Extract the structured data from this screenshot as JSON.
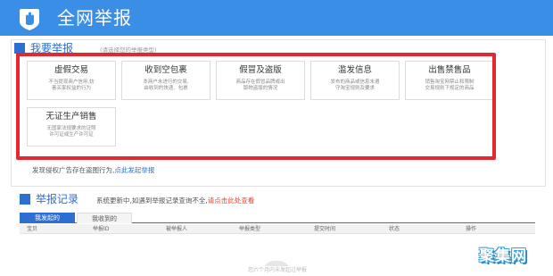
{
  "header": {
    "title": "全网举报"
  },
  "report_section": {
    "title": "我要举报",
    "hint": "(请选择您的举报类型)",
    "categories": [
      {
        "title": "虚假交易",
        "desc": "不当提现商户信用,妨\n害买家权益的行为"
      },
      {
        "title": "收到空包裹",
        "desc": "本商户未进行的交易,\n由收到的快递、包裹"
      },
      {
        "title": "假冒及盗版",
        "desc": "商品存在假冒品牌或出\n版物盗版的情况"
      },
      {
        "title": "滥发信息",
        "desc": "发布的商品或信息未遵\n守淘宝规则及要求"
      },
      {
        "title": "出售禁售品",
        "desc": "销售淘宝网禁止和限制\n交易规则下规定的商品"
      },
      {
        "title": "无证生产销售",
        "desc": "无国家法规要求的证照\n许可证或生产许可证"
      }
    ],
    "report_line": {
      "text": "发现侵权广告存在盗图行为,",
      "link": "点此发起举报"
    }
  },
  "records": {
    "title": "举报记录",
    "notice": "系统更新中,如遇到举报记录查询不全,",
    "notice_link": "请点击此处查看",
    "tabs": [
      "我发起的",
      "我收到的"
    ],
    "columns": [
      "宝贝",
      "举报ID",
      "被举报人",
      "举报类型",
      "提交时间",
      "状态",
      "操作"
    ],
    "empty_text": "您六个月内未发起过举报"
  },
  "watermark": "聚集网",
  "colors": {
    "brand": "#3a8ee6",
    "accent": "#2d6fd0",
    "highlight": "#e5272e"
  }
}
